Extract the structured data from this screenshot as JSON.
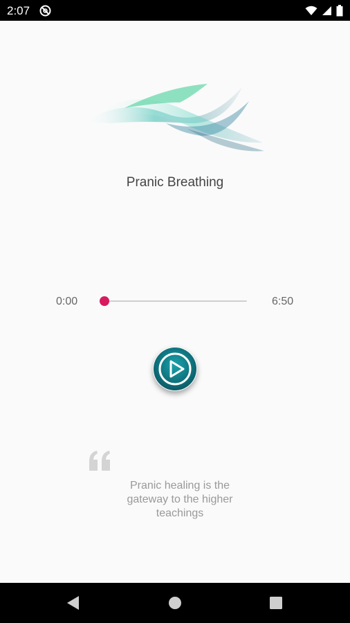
{
  "status_bar": {
    "time": "2:07",
    "icons": [
      "do-not-disturb-icon",
      "wifi-icon",
      "signal-icon",
      "battery-icon"
    ]
  },
  "player": {
    "title": "Pranic Breathing",
    "current_time": "0:00",
    "total_time": "6:50",
    "progress_fraction": 0.0,
    "accent_color": "#d81b60",
    "play_button_color": "#0e7c86"
  },
  "quote": {
    "text": "Pranic healing is the gateway to the higher teachings"
  },
  "nav_bar": {
    "buttons": [
      "back-icon",
      "home-icon",
      "recents-icon"
    ]
  }
}
